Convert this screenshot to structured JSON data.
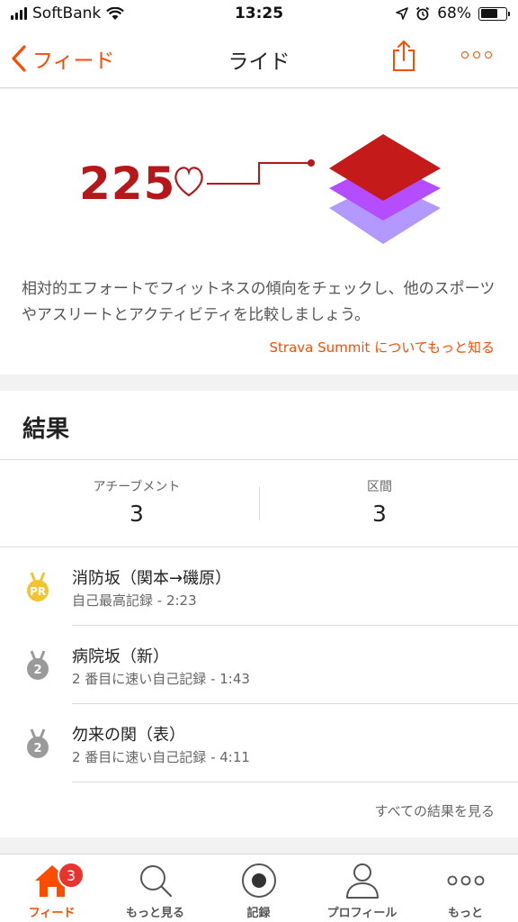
{
  "status_bar": {
    "carrier": "SoftBank",
    "time": "13:25",
    "battery": "68%",
    "battery_level": 0.68
  },
  "nav": {
    "back_label": "フィード",
    "title": "ライド"
  },
  "summit": {
    "number": "225",
    "description": "相対的エフォートでフィットネスの傾向をチェックし、他のスポーツやアスリートとアクティビティを比較しましょう。",
    "link": "Strava Summit についてもっと知る",
    "colors": {
      "primary": "#b5171b",
      "layer_top": "#c41a1a",
      "layer_mid": "#b34dff",
      "layer_bottom": "#b399ff"
    }
  },
  "results": {
    "title": "結果",
    "stats": [
      {
        "label": "アチーブメント",
        "value": "3"
      },
      {
        "label": "区間",
        "value": "3"
      }
    ],
    "segments": [
      {
        "name": "消防坂（関本→磯原）",
        "detail": "自己最高記録 - 2:23",
        "medal": "PR",
        "medal_color": "#f4c430"
      },
      {
        "name": "病院坂（新）",
        "detail": "2 番目に速い自己記録 - 1:43",
        "medal": "2",
        "medal_color": "#9a9a9a"
      },
      {
        "name": "勿来の関（表）",
        "detail": "2 番目に速い自己記録 - 4:11",
        "medal": "2",
        "medal_color": "#9a9a9a"
      }
    ],
    "see_all": "すべての結果を見る"
  },
  "tabs": [
    {
      "label": "フィード",
      "icon": "home-icon",
      "active": true,
      "badge": "3"
    },
    {
      "label": "もっと見る",
      "icon": "search-icon"
    },
    {
      "label": "記録",
      "icon": "record-icon"
    },
    {
      "label": "プロフィール",
      "icon": "profile-icon"
    },
    {
      "label": "もっと",
      "icon": "more-icon"
    }
  ],
  "accent": "#fc4c02"
}
